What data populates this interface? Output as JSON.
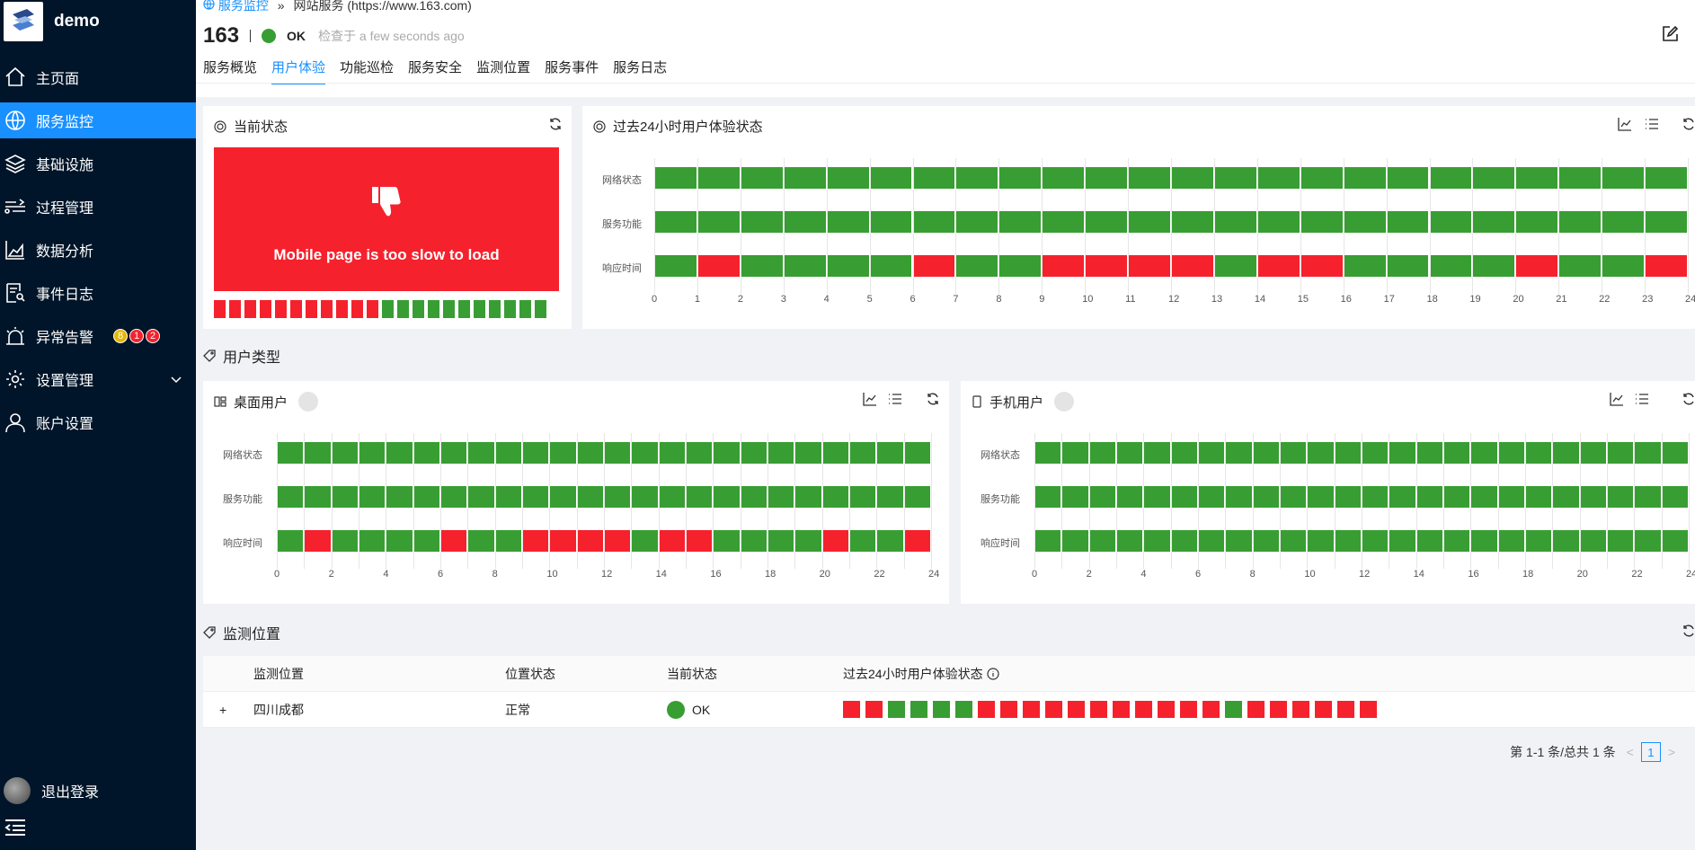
{
  "app": {
    "name": "demo"
  },
  "colors": {
    "ok": "#389e33",
    "bad": "#f5222d",
    "accent": "#1890ff",
    "sidebar": "#001529"
  },
  "sidebar": {
    "items": [
      {
        "label": "主页面",
        "icon": "home-icon"
      },
      {
        "label": "服务监控",
        "icon": "globe-icon",
        "active": true
      },
      {
        "label": "基础设施",
        "icon": "layers-icon"
      },
      {
        "label": "过程管理",
        "icon": "flow-icon"
      },
      {
        "label": "数据分析",
        "icon": "area-chart-icon"
      },
      {
        "label": "事件日志",
        "icon": "log-search-icon"
      },
      {
        "label": "异常告警",
        "icon": "alarm-icon"
      },
      {
        "label": "设置管理",
        "icon": "gear-icon"
      },
      {
        "label": "账户设置",
        "icon": "user-icon"
      }
    ],
    "alarm_badges": [
      "8",
      "1",
      "2"
    ],
    "logout": "退出登录"
  },
  "breadcrumb": {
    "parent": "服务监控",
    "sep": "»",
    "current": "网站服务 (https://www.163.com)"
  },
  "header": {
    "title": "163",
    "status": "OK",
    "checked": "检查于 a few seconds ago"
  },
  "tabs": [
    "服务概览",
    "用户体验",
    "功能巡检",
    "服务安全",
    "监测位置",
    "服务事件",
    "服务日志"
  ],
  "current_state": {
    "title": "当前状态",
    "message": "Mobile page is too slow to load",
    "history": [
      "bad",
      "bad",
      "bad",
      "bad",
      "bad",
      "bad",
      "bad",
      "bad",
      "bad",
      "bad",
      "bad",
      "ok",
      "ok",
      "ok",
      "ok",
      "ok",
      "ok",
      "ok",
      "ok",
      "ok",
      "ok",
      "ok"
    ]
  },
  "past24": {
    "title": "过去24小时用户体验状态",
    "rows": [
      {
        "label": "网络状态",
        "cells": "gggggggggggggggggggggggg"
      },
      {
        "label": "服务功能",
        "cells": "gggggggggggggggggggggggg"
      },
      {
        "label": "响应时间",
        "cells": "grggggrggrrrrgrrggggrggrr"
      }
    ],
    "ticks": [
      "0",
      "1",
      "2",
      "3",
      "4",
      "5",
      "6",
      "7",
      "8",
      "9",
      "10",
      "11",
      "12",
      "13",
      "14",
      "15",
      "16",
      "17",
      "18",
      "19",
      "20",
      "21",
      "22",
      "23",
      "24"
    ]
  },
  "user_type": {
    "title": "用户类型",
    "desktop": {
      "title": "桌面用户",
      "rows": [
        {
          "label": "网络状态",
          "cells": "gggggggggggggggggggggggg"
        },
        {
          "label": "服务功能",
          "cells": "gggggggggggggggggggggggg"
        },
        {
          "label": "响应时间",
          "cells": "grggggrggrrrrgrrggggrggrr"
        }
      ]
    },
    "mobile": {
      "title": "手机用户",
      "rows": [
        {
          "label": "网络状态",
          "cells": "gggggggggggggggggggggggg"
        },
        {
          "label": "服务功能",
          "cells": "gggggggggggggggggggggggg"
        },
        {
          "label": "响应时间",
          "cells": "gggggggggggggggggggggggg"
        }
      ]
    },
    "ticks": [
      "0",
      "2",
      "4",
      "6",
      "8",
      "10",
      "12",
      "14",
      "16",
      "18",
      "20",
      "22",
      "24"
    ]
  },
  "locations": {
    "title": "监测位置",
    "columns": [
      "监测位置",
      "位置状态",
      "当前状态",
      "过去24小时用户体验状态"
    ],
    "rows": [
      {
        "expand": "+",
        "name": "四川成都",
        "state": "正常",
        "status": "OK",
        "history": [
          "bad",
          "bad",
          "ok",
          "ok",
          "ok",
          "ok",
          "bad",
          "bad",
          "bad",
          "bad",
          "bad",
          "bad",
          "bad",
          "bad",
          "bad",
          "bad",
          "bad",
          "ok",
          "bad",
          "bad",
          "bad",
          "bad",
          "bad",
          "bad"
        ]
      }
    ],
    "pager": {
      "summary": "第 1-1 条/总共 1 条",
      "page": "1"
    }
  }
}
